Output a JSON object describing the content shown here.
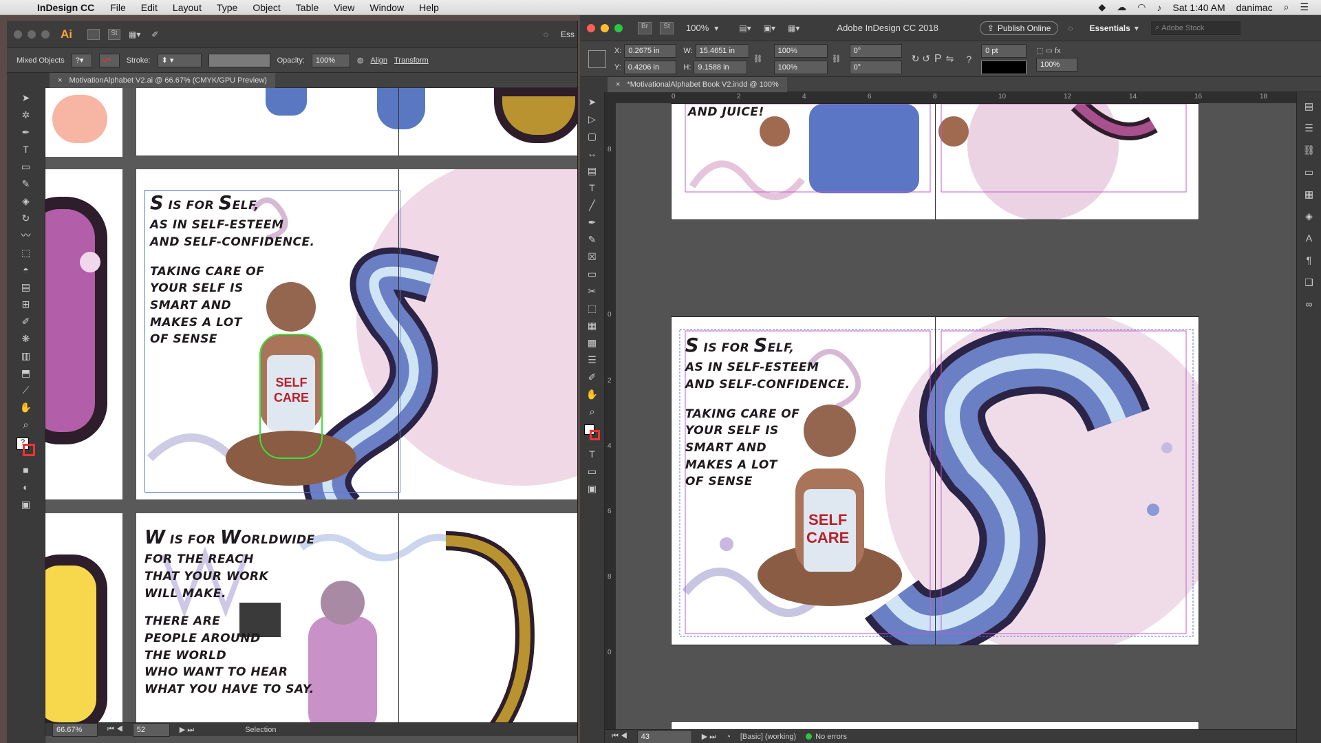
{
  "menubar": {
    "app": "InDesign CC",
    "items": [
      "File",
      "Edit",
      "Layout",
      "Type",
      "Object",
      "Table",
      "View",
      "Window",
      "Help"
    ],
    "clock": "Sat 1:40 AM",
    "user": "danimac"
  },
  "illustrator": {
    "logo": "Ai",
    "workspace": "Ess",
    "control": {
      "selection": "Mixed Objects",
      "stroke_label": "Stroke:",
      "opacity_label": "Opacity:",
      "opacity_value": "100%",
      "align": "Align",
      "transform": "Transform"
    },
    "tab": "MotivationAlphabet V2.ai @ 66.67% (CMYK/GPU Preview)",
    "status": {
      "zoom": "66.67%",
      "page": "52",
      "tool": "Selection"
    },
    "page_s": {
      "line1a": "S",
      "line1b": " IS FOR ",
      "line1c": "S",
      "line1d": "ELF,",
      "line2": "AS IN SELF-ESTEEM",
      "line3": "AND SELF-CONFIDENCE.",
      "body": [
        "TAKING CARE OF",
        "YOUR SELF IS",
        "SMART AND",
        "MAKES A LOT",
        "OF SENSE"
      ],
      "shirt": [
        "SELF",
        "CARE"
      ]
    },
    "page_w": {
      "line1a": "W",
      "line1b": " IS FOR ",
      "line1c": "W",
      "line1d": "ORLDWIDE",
      "lines": [
        "FOR THE REACH",
        "THAT YOUR WORK",
        "WILL MAKE."
      ],
      "body": [
        "THERE ARE",
        "PEOPLE AROUND",
        "THE WORLD",
        "WHO WANT TO HEAR",
        "WHAT YOU HAVE TO SAY."
      ]
    }
  },
  "indesign": {
    "title": "Adobe InDesign CC 2018",
    "publish": "Publish Online",
    "workspace": "Essentials",
    "search_placeholder": "Adobe Stock",
    "zoom": "100%",
    "control": {
      "x_label": "X:",
      "x": "0.2675 in",
      "y_label": "Y:",
      "y": "0.4206 in",
      "w_label": "W:",
      "w": "15.4651 in",
      "h_label": "H:",
      "h": "9.1588 in",
      "scale_x": "100%",
      "scale_y": "100%",
      "rot": "0°",
      "shear": "0°",
      "stroke_w": "0 pt",
      "opacity": "100%"
    },
    "tab": "*MotivationalAlphabet Book V2.indd @ 100%",
    "ruler": [
      "0",
      "2",
      "4",
      "6",
      "8",
      "10",
      "12",
      "14",
      "16",
      "18"
    ],
    "ruler_v": [
      "8",
      "0",
      "2",
      "4",
      "6",
      "8",
      "0"
    ],
    "top_page_text": "AND JUICE!",
    "page_s": {
      "line1a": "S",
      "line1b": " IS FOR ",
      "line1c": "S",
      "line1d": "ELF,",
      "line2": "AS IN SELF-ESTEEM",
      "line3": "AND SELF-CONFIDENCE.",
      "body": [
        "TAKING CARE OF",
        "YOUR SELF IS",
        "SMART AND",
        "MAKES A LOT",
        "OF SENSE"
      ],
      "shirt": [
        "SELF",
        "CARE"
      ]
    },
    "status": {
      "page": "43",
      "style": "[Basic] (working)",
      "errors": "No errors"
    }
  },
  "colors": {
    "accent_pink": "#e8b8d8",
    "s_blue": "#6b7fc4",
    "mac_red": "#fe5f57",
    "mac_yellow": "#febc2e",
    "mac_green": "#28c840"
  }
}
